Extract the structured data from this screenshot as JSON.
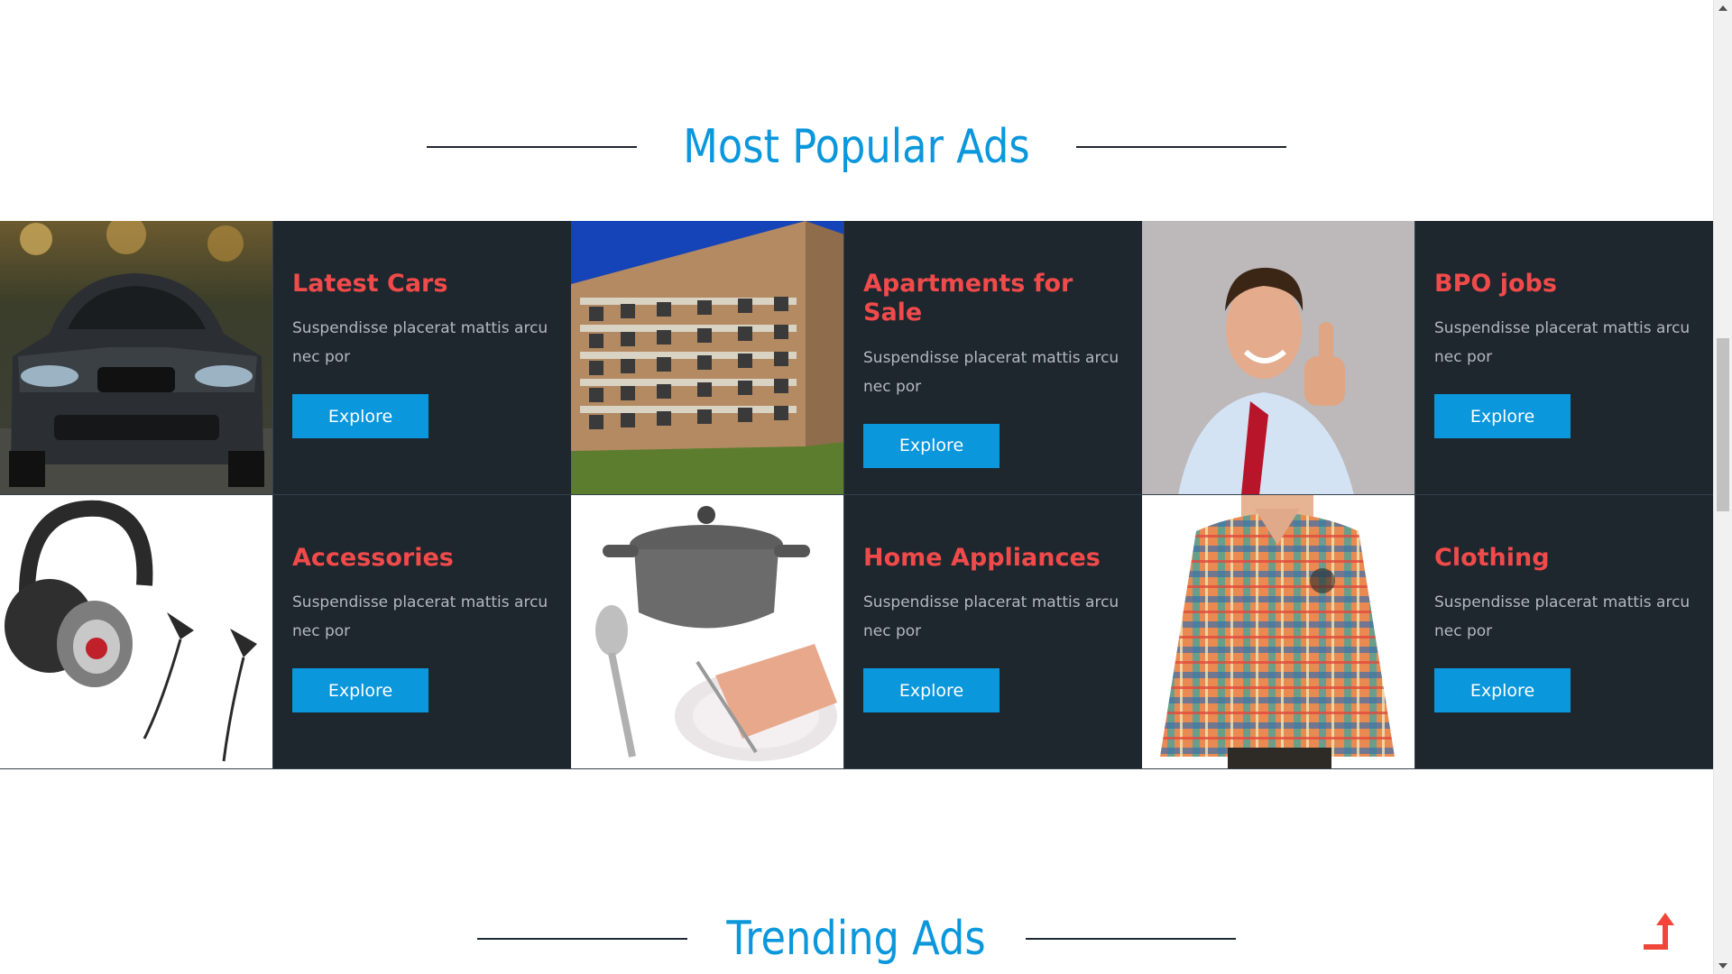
{
  "sections": {
    "popular_title": "Most Popular Ads",
    "trending_title": "Trending Ads"
  },
  "ads": [
    {
      "title": "Latest Cars",
      "description": "Suspendisse placerat mattis arcu nec por",
      "button": "Explore",
      "image_icon": "car-image"
    },
    {
      "title": "Apartments for Sale",
      "description": "Suspendisse placerat mattis arcu nec por",
      "button": "Explore",
      "image_icon": "apartment-building-image"
    },
    {
      "title": "BPO jobs",
      "description": "Suspendisse placerat mattis arcu nec por",
      "button": "Explore",
      "image_icon": "businessman-thumbs-up-image"
    },
    {
      "title": "Accessories",
      "description": "Suspendisse placerat mattis arcu nec por",
      "button": "Explore",
      "image_icon": "headphones-image"
    },
    {
      "title": "Home Appliances",
      "description": "Suspendisse placerat mattis arcu nec por",
      "button": "Explore",
      "image_icon": "cookware-image"
    },
    {
      "title": "Clothing",
      "description": "Suspendisse placerat mattis arcu nec por",
      "button": "Explore",
      "image_icon": "plaid-shirt-image"
    }
  ],
  "colors": {
    "accent_blue": "#0a97dc",
    "card_bg": "#1e262e",
    "title_red": "#f04a4a",
    "desc_gray": "#b3b9bf"
  },
  "icons": {
    "back_to_top": "back-to-top-arrow-icon",
    "scroll_up": "scroll-up-arrow-icon",
    "scroll_down": "scroll-down-arrow-icon"
  }
}
